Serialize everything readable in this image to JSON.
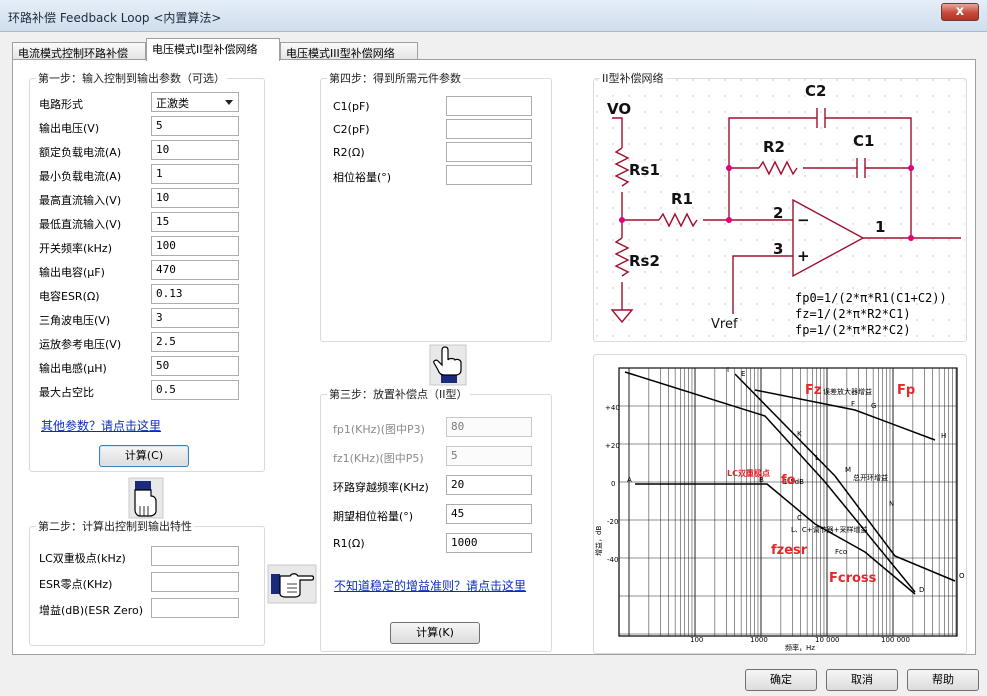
{
  "window": {
    "title": "环路补偿 Feedback Loop  <内置算法>",
    "close": "x"
  },
  "tabs": [
    {
      "label": "电流模式控制环路补偿"
    },
    {
      "label": "电压模式II型补偿网络"
    },
    {
      "label": "电压模式III型补偿网络"
    }
  ],
  "step1": {
    "legend": "第一步：输入控制到输出参数（可选）",
    "circuit_label": "电路形式",
    "circuit_value": "正激类",
    "rows": [
      {
        "label": "输出电压(V)",
        "value": "5"
      },
      {
        "label": "额定负载电流(A)",
        "value": "10"
      },
      {
        "label": "最小负载电流(A)",
        "value": "1"
      },
      {
        "label": "最高直流输入(V)",
        "value": "10"
      },
      {
        "label": "最低直流输入(V)",
        "value": "15"
      },
      {
        "label": "开关频率(kHz)",
        "value": "100"
      },
      {
        "label": "输出电容(μF)",
        "value": "470"
      },
      {
        "label": "电容ESR(Ω)",
        "value": "0.13"
      },
      {
        "label": "三角波电压(V)",
        "value": "3"
      },
      {
        "label": "运放参考电压(V)",
        "value": "2.5"
      },
      {
        "label": "输出电感(μH)",
        "value": "50"
      },
      {
        "label": "最大占空比",
        "value": "0.5"
      }
    ],
    "link": "其他参数？请点击这里",
    "button": "计算(C)"
  },
  "step2": {
    "legend": "第二步：计算出控制到输出特性",
    "rows": [
      {
        "label": "LC双重极点(kHz)",
        "value": ""
      },
      {
        "label": "ESR零点(KHz)",
        "value": ""
      },
      {
        "label": "增益(dB)(ESR Zero)",
        "value": ""
      }
    ]
  },
  "step4": {
    "legend": "第四步：得到所需元件参数",
    "rows": [
      {
        "label": "C1(pF)",
        "value": ""
      },
      {
        "label": "C2(pF)",
        "value": ""
      },
      {
        "label": "R2(Ω)",
        "value": ""
      },
      {
        "label": "相位裕量(°)",
        "value": ""
      }
    ]
  },
  "step3": {
    "legend": "第三步：放置补偿点（II型）",
    "rows": [
      {
        "label": "fp1(KHz)(图中P3)",
        "value": "80",
        "disabled": true
      },
      {
        "label": "fz1(KHz)(图中P5)",
        "value": "5",
        "disabled": true
      },
      {
        "label": "环路穿越频率(KHz)",
        "value": "20",
        "disabled": false
      },
      {
        "label": "期望相位裕量(°)",
        "value": "45",
        "disabled": false
      },
      {
        "label": "R1(Ω)",
        "value": "1000",
        "disabled": false
      }
    ],
    "link": "不知道稳定的增益准则？请点击这里",
    "button": "计算(K)"
  },
  "schematic": {
    "legend": "II型补偿网络",
    "VO": "VO",
    "Rs1": "Rs1",
    "Rs2": "Rs2",
    "R1": "R1",
    "R2": "R2",
    "C1": "C1",
    "C2": "C2",
    "pin2": "2",
    "pin3": "3",
    "pin1": "1",
    "minus": "−",
    "plus": "+",
    "Vref": "Vref",
    "formulas": [
      "fp0=1/(2*π*R1(C1+C2))",
      "fz=1/(2*π*R2*C1)",
      "fp=1/(2*π*R2*C2)"
    ]
  },
  "bode": {
    "y_ticks": [
      "+40",
      "+20",
      "0",
      "-20",
      "-40"
    ],
    "x_ticks": [
      "100",
      "1000",
      "10 000",
      "100 000"
    ],
    "y_axis": "增益，dB",
    "x_axis": "频率，Hz",
    "labels": {
      "Fz": "Fz",
      "Fp": "Fp",
      "Fo": "fo",
      "lc": "LC双重极点",
      "fzesr": "fzesr",
      "fcross": "Fcross",
      "amp": "误差放大器增益",
      "openloop": "总开环增益",
      "lcreg": "L、C+调节器+采样增益",
      "A": "A",
      "B": "B",
      "C": "C",
      "D": "D",
      "E": "E",
      "F": "F",
      "G": "G",
      "H": "H",
      "I": "I",
      "K": "K",
      "L": "L",
      "M": "M",
      "N": "N",
      "O": "O",
      "Fco": "Fco",
      "db": "-1.5dB"
    }
  },
  "footer": {
    "ok": "确定",
    "cancel": "取消",
    "help": "帮助"
  },
  "colors": {
    "node": "#e0007a",
    "wire": "#c0143c",
    "red_label": "#e8262b",
    "link": "#0b2dbf"
  }
}
